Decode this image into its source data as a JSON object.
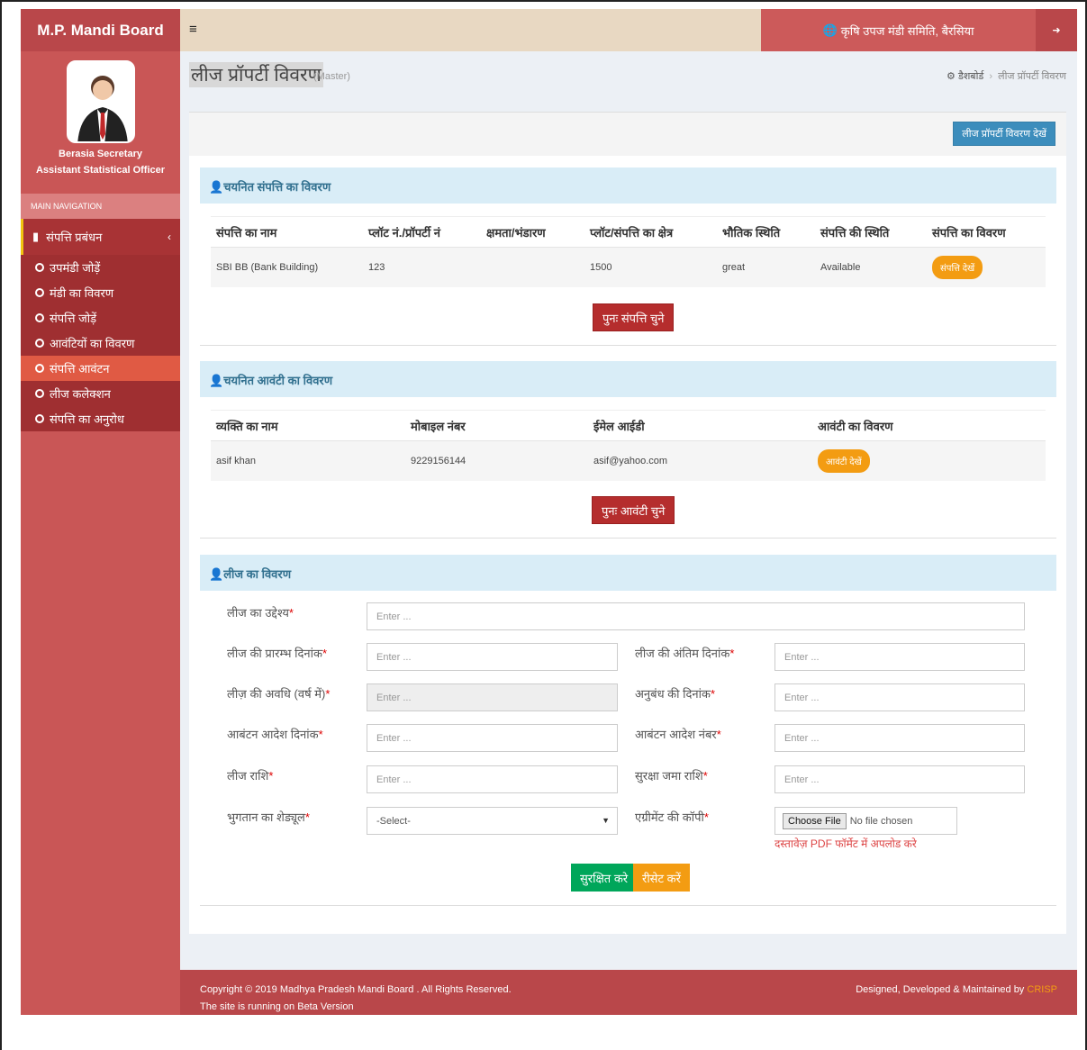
{
  "header": {
    "logo": "M.P. Mandi Board",
    "org": "कृषि उपज मंडी समिति, बैरसिया"
  },
  "user": {
    "name": "Berasia Secretary",
    "role": "Assistant Statistical Officer"
  },
  "sidebar": {
    "nav_header": "MAIN NAVIGATION",
    "parent": "संपत्ति प्रबंधन",
    "items": [
      {
        "label": "उपमंडी जोड़ें"
      },
      {
        "label": "मंडी का विवरण"
      },
      {
        "label": "संपत्ति जोड़ें"
      },
      {
        "label": "आवंटियों का विवरण"
      },
      {
        "label": "संपत्ति आवंटन"
      },
      {
        "label": "लीज कलेक्शन"
      },
      {
        "label": "संपत्ति का अनुरोध"
      }
    ]
  },
  "page": {
    "title": "लीज प्रॉपर्टी विवरण",
    "subtitle": "(Master)",
    "breadcrumb_home": "डैशबोर्ड",
    "breadcrumb_current": "लीज प्रॉपर्टी विवरण",
    "view_button": "लीज प्रॉपर्टी विवरण देखें"
  },
  "property_section": {
    "title": "चयनित संपत्ति का विवरण",
    "headers": [
      "संपत्ति का नाम",
      "प्लॉट नं./प्रॉपर्टी नं",
      "क्षमता/भंडारण",
      "प्लॉट/संपत्ति का क्षेत्र",
      "भौतिक स्थिति",
      "संपत्ति की स्थिति",
      "संपत्ति का विवरण"
    ],
    "row": {
      "name": "SBI BB (Bank Building)",
      "plot": "123",
      "capacity": "",
      "area": "1500",
      "condition": "great",
      "status": "Available",
      "details_btn": "संपत्ति देखें"
    },
    "reselect_btn": "पुनः संपत्ति चुने"
  },
  "allottee_section": {
    "title": "चयनित आवंटी का विवरण",
    "headers": [
      "व्यक्ति का नाम",
      "मोबाइल नंबर",
      "ईमेल आईडी",
      "आवंटी का विवरण"
    ],
    "row": {
      "name": "asif khan",
      "mobile": "9229156144",
      "email": "asif@yahoo.com",
      "details_btn": "आवंटी देखें"
    },
    "reselect_btn": "पुनः आवंटी चुने"
  },
  "lease_section": {
    "title": "लीज का विवरण",
    "placeholder": "Enter ...",
    "purpose_label": "लीज का उद्देश्य",
    "start_label": "लीज की प्रारम्भ दिनांक",
    "end_label": "लीज की अंतिम दिनांक",
    "duration_label": "लीज़ की अवधि (वर्ष में)",
    "agreement_date_label": "अनुबंध की दिनांक",
    "order_date_label": "आबंटन आदेश दिनांक",
    "order_no_label": "आबंटन आदेश नंबर",
    "amount_label": "लीज राशि",
    "deposit_label": "सुरक्षा जमा राशि",
    "schedule_label": "भुगतान का शेड्यूल",
    "schedule_value": "-Select-",
    "copy_label": "एग्रीमेंट की कॉपी",
    "file_button": "Choose File",
    "file_status": "No file chosen",
    "file_hint": "दस्तावेज़ PDF फॉर्मेट में अपलोड करे",
    "save_btn": "सुरक्षित करे",
    "reset_btn": "रीसेट करें"
  },
  "footer": {
    "copyright": "Copyright © 2019 Madhya Pradesh Mandi Board . All Rights Reserved.",
    "beta": "The site is running on Beta Version",
    "designed_by": "Designed, Developed & Maintained by",
    "brand": "CRISP"
  }
}
